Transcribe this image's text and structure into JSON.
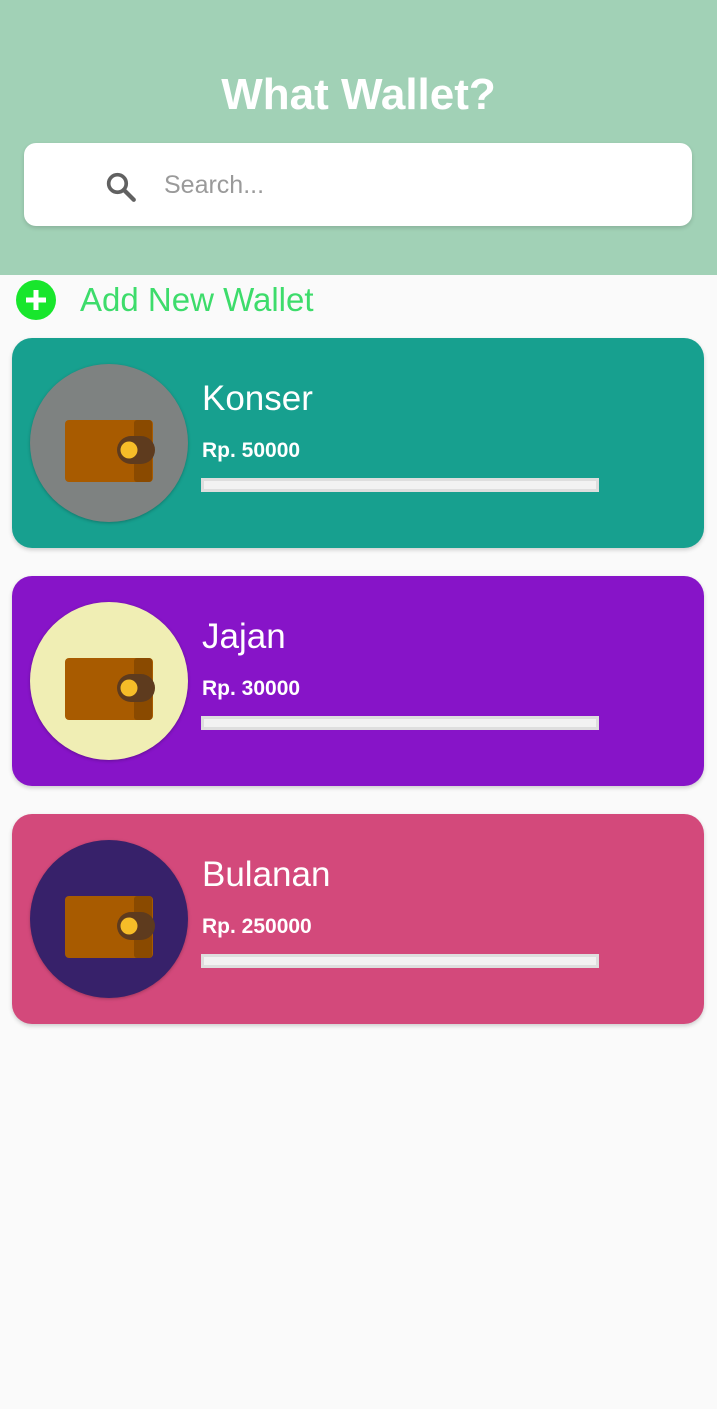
{
  "header": {
    "title": "What Wallet?",
    "background": "#a1d1b6"
  },
  "search": {
    "placeholder": "Search...",
    "value": "",
    "icon": "search-icon"
  },
  "add_wallet": {
    "label": "Add New Wallet",
    "icon": "plus-circle-icon",
    "color": "#3ddc6b"
  },
  "wallets": [
    {
      "name": "Konser",
      "amount": "Rp. 50000",
      "progress": 0,
      "card_color": "#17a08f",
      "avatar_color": "#7e8281",
      "icon": "wallet-icon"
    },
    {
      "name": "Jajan",
      "amount": "Rp. 30000",
      "progress": 0,
      "card_color": "#8714c8",
      "avatar_color": "#f0eeb4",
      "icon": "wallet-icon"
    },
    {
      "name": "Bulanan",
      "amount": "Rp. 250000",
      "progress": 0,
      "card_color": "#d3497b",
      "avatar_color": "#37216a",
      "icon": "wallet-icon"
    }
  ]
}
